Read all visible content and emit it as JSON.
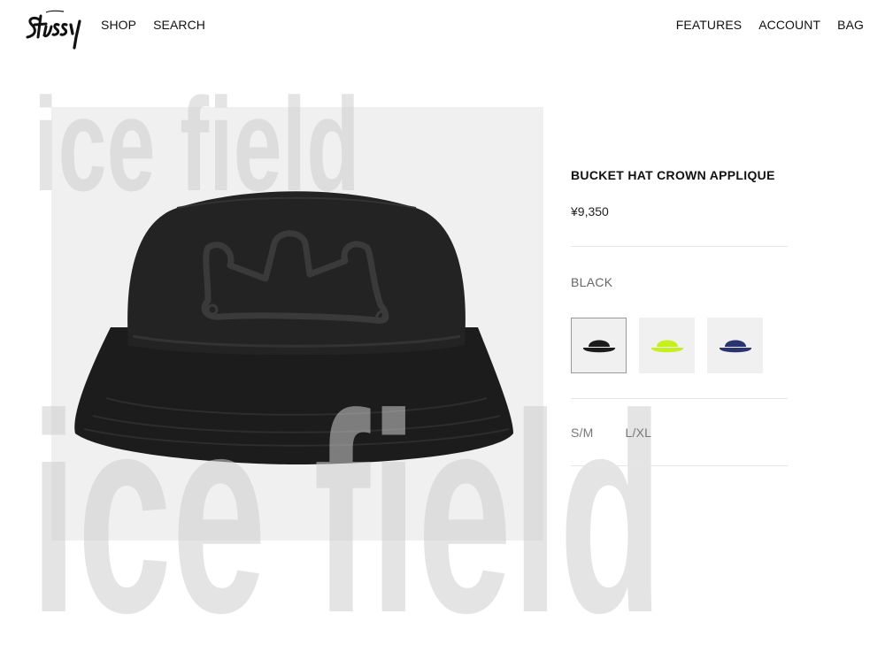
{
  "header": {
    "logo_text": "Stüssy",
    "nav_left": [
      {
        "label": "SHOP"
      },
      {
        "label": "SEARCH"
      }
    ],
    "nav_right": [
      {
        "label": "FEATURES"
      },
      {
        "label": "ACCOUNT"
      },
      {
        "label": "BAG"
      }
    ]
  },
  "product": {
    "title": "BUCKET HAT CROWN APPLIQUE",
    "price": "¥9,350",
    "selected_color": "BLACK",
    "colors": [
      {
        "name": "black",
        "hex": "#1b1b1b",
        "selected": true
      },
      {
        "name": "lime",
        "hex": "#c6ef1f",
        "selected": false
      },
      {
        "name": "navy",
        "hex": "#2b3470",
        "selected": false
      }
    ],
    "sizes": [
      {
        "label": "S/M"
      },
      {
        "label": "L/XL"
      }
    ]
  },
  "watermark": {
    "text": "ice field"
  },
  "colors": {
    "text": "#111111",
    "muted": "#777777",
    "image_bg": "#f0f0f0",
    "divider": "#e6e6e6"
  }
}
